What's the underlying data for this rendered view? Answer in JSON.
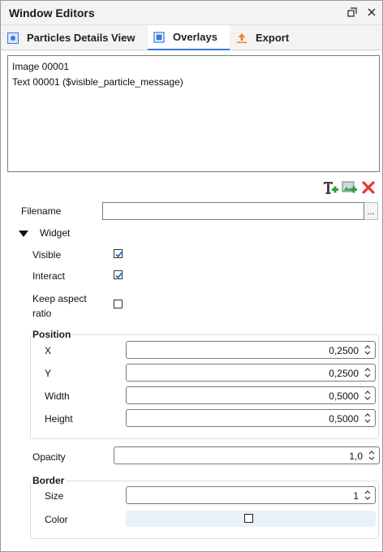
{
  "window": {
    "title": "Window Editors"
  },
  "tabs": [
    {
      "label": "Particles Details View",
      "icon": "view-icon",
      "active": false
    },
    {
      "label": "Overlays",
      "icon": "overlay-icon",
      "active": true
    },
    {
      "label": "Export",
      "icon": "export-icon",
      "active": false
    }
  ],
  "overlay_list": [
    "Image 00001",
    "Text 00001 ($visible_particle_message)"
  ],
  "toolbar": {
    "add_text_icon": "add-text-icon",
    "add_image_icon": "add-image-icon",
    "delete_icon": "delete-icon"
  },
  "filename": {
    "label": "Filename",
    "value": "",
    "browse_label": "..."
  },
  "widget": {
    "label": "Widget",
    "visible_label": "Visible",
    "visible": true,
    "interact_label": "Interact",
    "interact": true,
    "keep_aspect_label_line1": "Keep aspect",
    "keep_aspect_label_line2": "ratio",
    "keep_aspect": false
  },
  "position": {
    "title": "Position",
    "x_label": "X",
    "x_value": "0,2500",
    "y_label": "Y",
    "y_value": "0,2500",
    "width_label": "Width",
    "width_value": "0,5000",
    "height_label": "Height",
    "height_value": "0,5000"
  },
  "opacity": {
    "label": "Opacity",
    "value": "1,0"
  },
  "border": {
    "title": "Border",
    "size_label": "Size",
    "size_value": "1",
    "color_label": "Color"
  },
  "colors": {
    "accent": "#3c78d8",
    "export_orange": "#e8862a",
    "delete_red": "#e53935",
    "add_green": "#2e9e3e",
    "color_field_bg": "#e9f1fb"
  }
}
